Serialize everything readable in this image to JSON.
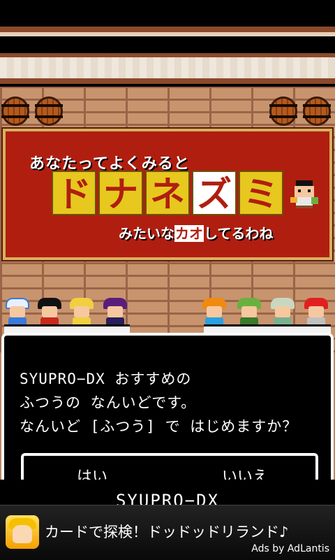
{
  "sign": {
    "line_top": "あなたってよくみると",
    "title_chars": [
      "ド",
      "ナ",
      "ネ",
      "ズ",
      "ミ"
    ],
    "line_bottom_before": "みたいな",
    "line_bottom_highlight": "カオ",
    "line_bottom_after": "してるわね"
  },
  "dialog": {
    "line1": "SYUPRO−DX おすすめの",
    "line2": "ふつうの なんいどです。",
    "line3": "なんいど [ふつう] で はじめますか？",
    "choices": {
      "yes": "はい",
      "no": "いいえ"
    }
  },
  "subtitle": "SYUPRO−DX",
  "ad": {
    "text": "カードで探検！ドッドッドリランド♪",
    "credit": "Ads by AdLantis",
    "icon": "ad-app-icon"
  },
  "characters": [
    {
      "name": "priest",
      "hair": "#e8f0ff",
      "body": "#3a7ad8"
    },
    {
      "name": "black-hair-girl",
      "hair": "#111111",
      "body": "#c8281c"
    },
    {
      "name": "blonde-fighter",
      "hair": "#f0d040",
      "body": "#f0d040"
    },
    {
      "name": "purple-hat-mage",
      "hair": "#5a1e7a",
      "body": "#2a1e5a"
    },
    {
      "name": "orange-hair-girl",
      "hair": "#f08a10",
      "body": "#2aa0e0"
    },
    {
      "name": "green-hair-boy",
      "hair": "#6ab040",
      "body": "#3a7a2a"
    },
    {
      "name": "silver-hair-elf",
      "hair": "#c8d8c0",
      "body": "#7ab090"
    },
    {
      "name": "red-horned-knight",
      "hair": "#e02020",
      "body": "#c0c0c0"
    }
  ],
  "colors": {
    "sign_red": "#b01e10",
    "title_yellow": "#e6c81e",
    "dialog_bg": "#000000"
  }
}
